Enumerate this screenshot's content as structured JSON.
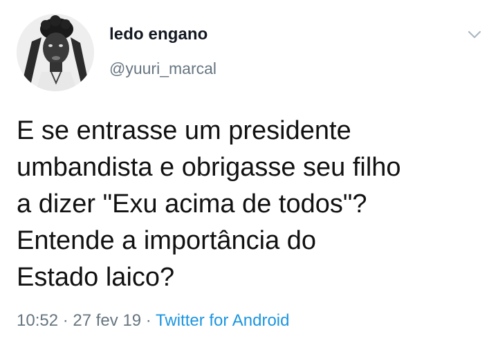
{
  "tweet": {
    "display_name": "ledo engano",
    "handle": "@yuuri_marcal",
    "text": "E se entrasse um presidente\numbandista e obrigasse seu filho\na dizer \"Exu acima de todos\"?\nEntende a importância do\nEstado laico?",
    "time": "10:52",
    "separator": " · ",
    "date": "27 fev 19",
    "source": "Twitter for Android"
  },
  "icons": {
    "menu": "chevron-down-icon",
    "avatar": "user-photo"
  },
  "colors": {
    "text": "#141823",
    "secondary": "#667580",
    "link": "#1b95e0"
  }
}
